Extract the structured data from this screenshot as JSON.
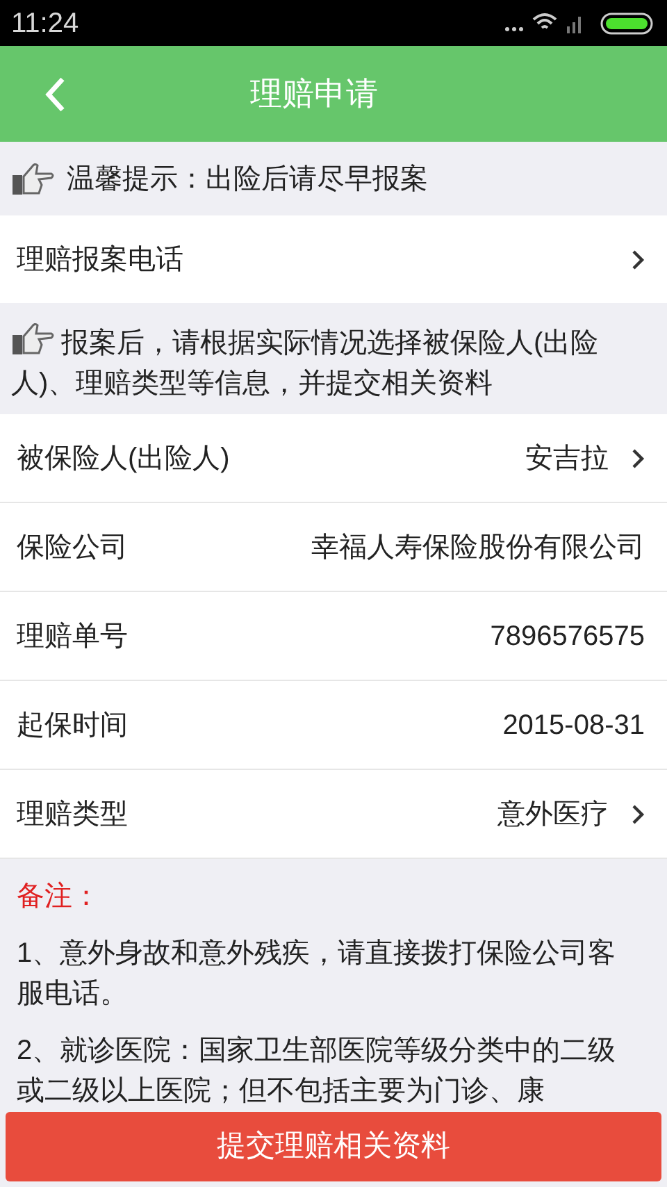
{
  "status_bar": {
    "time": "11:24"
  },
  "header": {
    "title": "理赔申请"
  },
  "tip": {
    "text": "温馨提示：出险后请尽早报案"
  },
  "phone_row": {
    "label": "理赔报案电话",
    "chevron": true
  },
  "tip2": {
    "text": "报案后，请根据实际情况选择被保险人(出险人)、理赔类型等信息，并提交相关资料"
  },
  "fields": [
    {
      "label": "被保险人(出险人)",
      "value": "安吉拉",
      "chevron": true
    },
    {
      "label": "保险公司",
      "value": "幸福人寿保险股份有限公司",
      "chevron": false
    },
    {
      "label": "理赔单号",
      "value": "7896576575",
      "chevron": false
    },
    {
      "label": "起保时间",
      "value": "2015-08-31",
      "chevron": false
    },
    {
      "label": "理赔类型",
      "value": "意外医疗",
      "chevron": true
    }
  ],
  "notes": {
    "title": "备注：",
    "items": [
      "1、意外身故和意外残疾，请直接拨打保险公司客服电话。",
      "2、就诊医院：国家卫生部医院等级分类中的二级或二级以上医院；但不包括主要为门诊、康"
    ]
  },
  "submit_button": {
    "label": "提交理赔相关资料"
  }
}
